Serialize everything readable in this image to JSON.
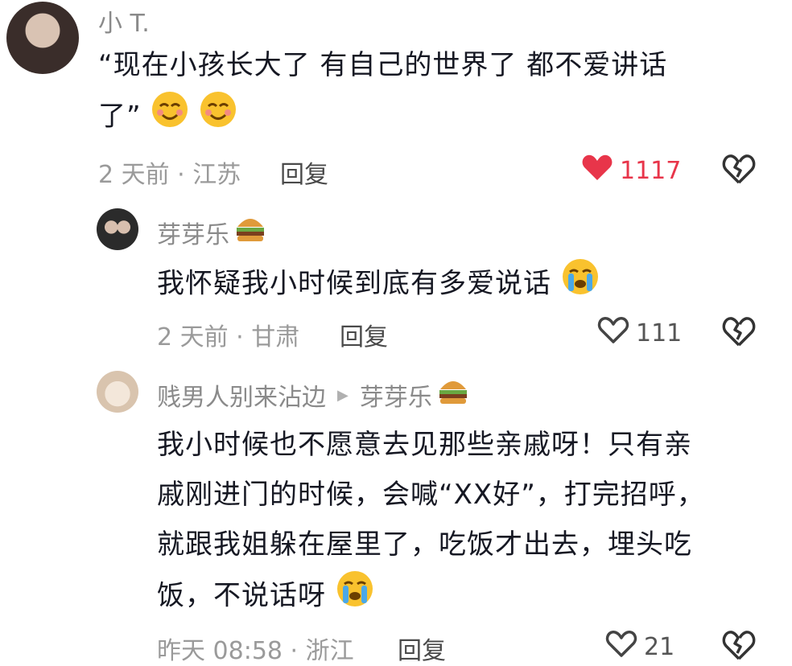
{
  "comments": [
    {
      "author": "小 T.",
      "text_lines": [
        "“现在小孩长大了 有自己的世界了 都不爱讲话",
        "了”"
      ],
      "meta": "2 天前 · 江苏",
      "reply_label": "回复",
      "likes": "1117",
      "liked": true,
      "emoji": [
        "blush-emoji",
        "blush-emoji"
      ]
    },
    {
      "author": "芽芽乐",
      "author_emoji": "hamburger-emoji",
      "text_lines": [
        "我怀疑我小时候到底有多爱说话"
      ],
      "emoji": [
        "crying-emoji"
      ],
      "meta": "2 天前 · 甘肃",
      "reply_label": "回复",
      "likes": "111",
      "liked": false
    },
    {
      "author": "贱男人别来沾边",
      "reply_to": "芽芽乐",
      "reply_to_emoji": "hamburger-emoji",
      "text_lines": [
        "我小时候也不愿意去见那些亲戚呀！只有亲",
        "戚刚进门的时候，会喊“XX好”，打完招呼，",
        "就跟我姐躲在屋里了，吃饭才出去，埋头吃",
        "饭，不说话呀"
      ],
      "emoji": [
        "crying-emoji"
      ],
      "meta": "昨天 08:58 · 浙江",
      "reply_label": "回复",
      "likes": "21",
      "liked": false
    }
  ],
  "colors": {
    "like_active": "#e8354a",
    "meta": "#9a9a9a",
    "author": "#8a8a8a"
  }
}
